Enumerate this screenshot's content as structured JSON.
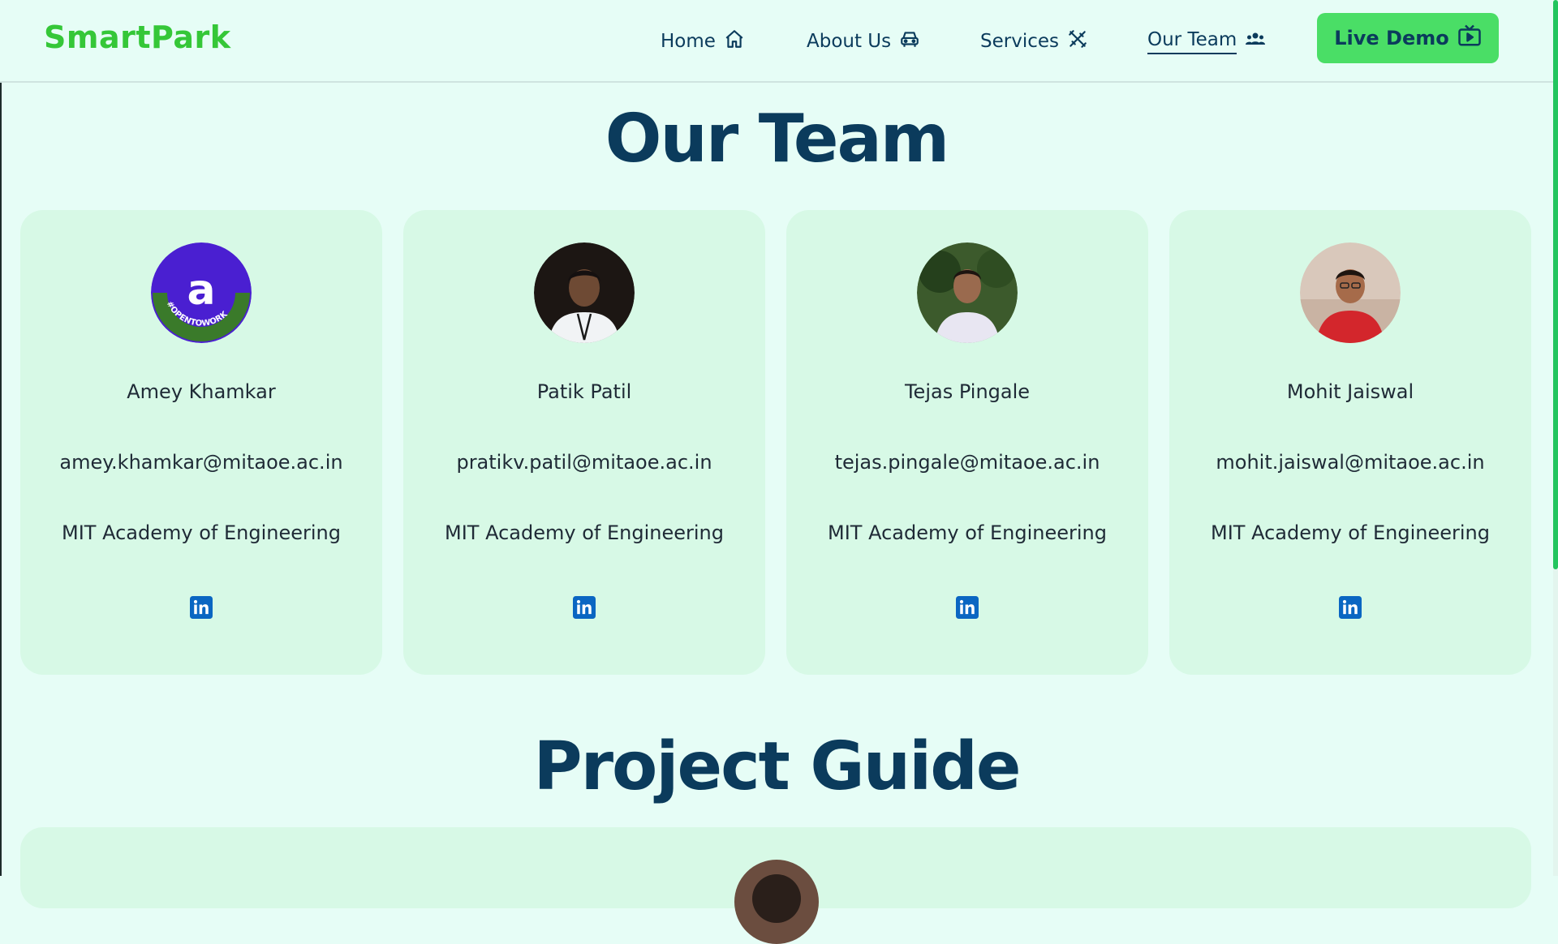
{
  "brand": "SmartPark",
  "nav": {
    "home": "Home",
    "about": "About Us",
    "services": "Services",
    "team": "Our Team",
    "live_demo": "Live Demo"
  },
  "sections": {
    "team_title": "Our Team",
    "guide_title": "Project Guide"
  },
  "team": [
    {
      "name": "Amey Khamkar",
      "email": "amey.khamkar@mitaoe.ac.in",
      "college": "MIT Academy of Engineering",
      "avatar_letter": "a",
      "badge_text": "#OPENTOWORK"
    },
    {
      "name": "Patik Patil",
      "email": "pratikv.patil@mitaoe.ac.in",
      "college": "MIT Academy of Engineering"
    },
    {
      "name": "Tejas Pingale",
      "email": "tejas.pingale@mitaoe.ac.in",
      "college": "MIT Academy of Engineering"
    },
    {
      "name": "Mohit Jaiswal",
      "email": "mohit.jaiswal@mitaoe.ac.in",
      "college": "MIT Academy of Engineering"
    }
  ],
  "colors": {
    "brand": "#35c738",
    "navy": "#0b3b5c",
    "background": "#e6fdf6",
    "card": "#d7f9e6",
    "button": "#4ade66",
    "linkedin": "#0a66c2"
  },
  "icons": {
    "home": "home-icon",
    "about": "car-icon",
    "services": "tools-icon",
    "team": "users-icon",
    "live_demo": "tv-play-icon",
    "social": "linkedin-icon"
  }
}
